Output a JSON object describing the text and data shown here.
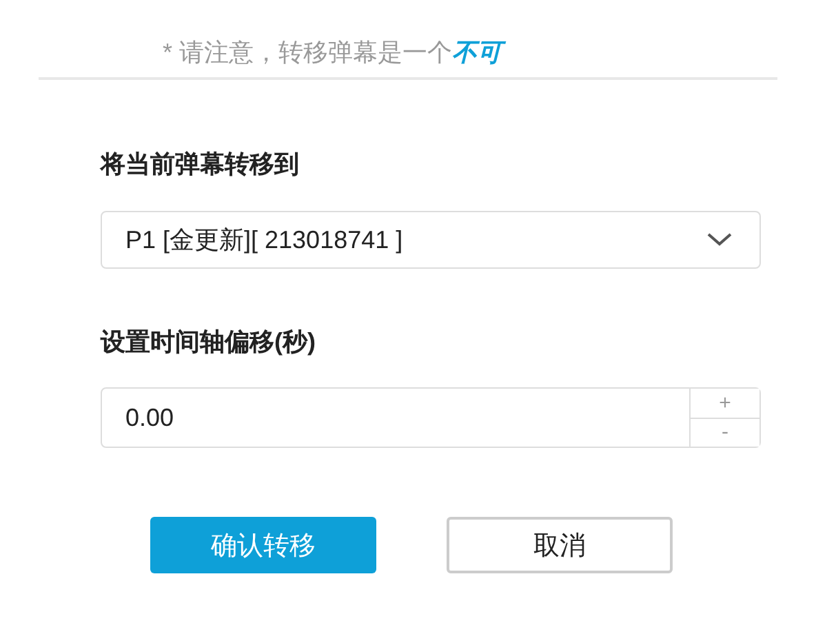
{
  "notice": {
    "prefix": "* 请注意，转移弹幕是一个",
    "emphasis": "不可"
  },
  "target": {
    "label": "将当前弹幕转移到",
    "value": "P1 [金更新][ 213018741 ]"
  },
  "offset": {
    "label": "设置时间轴偏移(秒)",
    "value": "0.00",
    "increment": "+",
    "decrement": "-"
  },
  "buttons": [
    {
      "label": "确认转移",
      "kind": "primary"
    },
    {
      "label": "取消",
      "kind": "secondary"
    }
  ]
}
